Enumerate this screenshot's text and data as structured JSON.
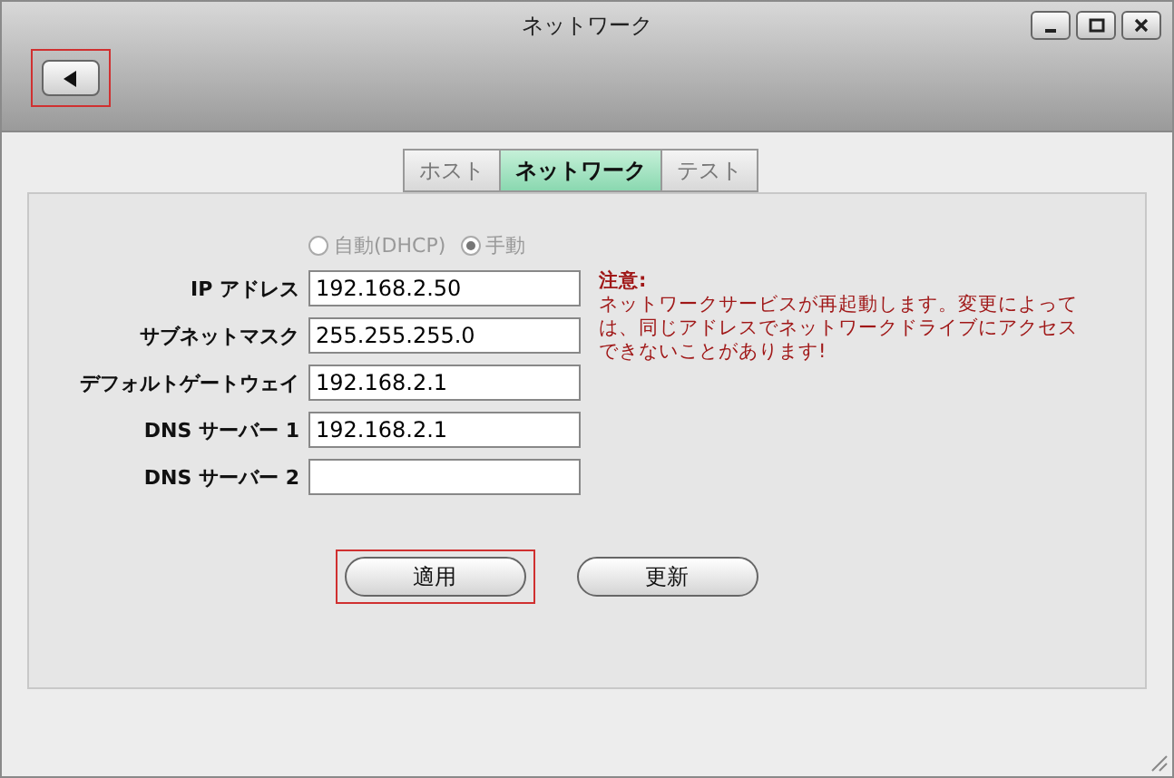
{
  "window": {
    "title": "ネットワーク"
  },
  "back_button": {
    "highlighted": true
  },
  "tabs": [
    {
      "label": "ホスト",
      "selected": false
    },
    {
      "label": "ネットワーク",
      "selected": true
    },
    {
      "label": "テスト",
      "selected": false
    }
  ],
  "mode": [
    {
      "label": "自動(DHCP)",
      "selected": false
    },
    {
      "label": "手動",
      "selected": true
    }
  ],
  "fields": [
    {
      "label": "IP アドレス",
      "value": "192.168.2.50"
    },
    {
      "label": "サブネットマスク",
      "value": "255.255.255.0"
    },
    {
      "label": "デフォルトゲートウェイ",
      "value": "192.168.2.1"
    },
    {
      "label": "DNS サーバー 1",
      "value": "192.168.2.1"
    },
    {
      "label": "DNS サーバー 2"
    }
  ],
  "notice": {
    "title": "注意:",
    "text": "ネットワークサービスが再起動します。変更によっては、同じアドレスでネットワークドライブにアクセスできないことがあります!"
  },
  "buttons": [
    {
      "label": "適用",
      "highlighted": true
    },
    {
      "label": "更新",
      "highlighted": false
    }
  ]
}
